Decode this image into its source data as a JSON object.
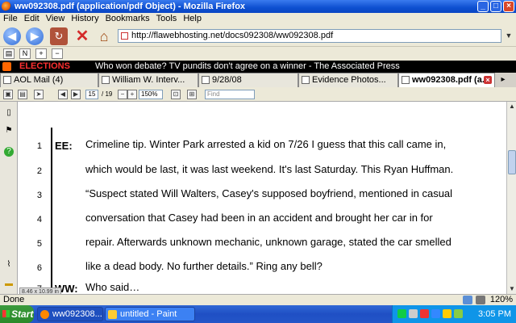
{
  "window": {
    "title": "ww092308.pdf (application/pdf Object) - Mozilla Firefox"
  },
  "menu": [
    "File",
    "Edit",
    "View",
    "History",
    "Bookmarks",
    "Tools",
    "Help"
  ],
  "nav": {
    "url": "http://flawebhosting.net/docs092308/ww092308.pdf"
  },
  "ticker": {
    "label": "ELECTIONS",
    "headline": "Who won debate? TV pundits don't agree on a winner - The Associated Press"
  },
  "tabs": [
    {
      "label": "AOL Mail (4)",
      "active": false
    },
    {
      "label": "William W. Interv...",
      "active": false
    },
    {
      "label": "9/28/08",
      "active": false
    },
    {
      "label": "Evidence Photos...",
      "active": false
    },
    {
      "label": "ww092308.pdf (a...",
      "active": true
    }
  ],
  "pdf_toolbar": {
    "page_current": "15",
    "page_total": "/ 19",
    "zoom": "150%",
    "find_placeholder": "Find"
  },
  "document": {
    "lines": [
      {
        "num": "1",
        "speaker": "EE:",
        "text": "Crimeline tip.  Winter Park arrested a kid on 7/26 I guess that this call came in,"
      },
      {
        "num": "2",
        "speaker": "",
        "text": "which would be last, it was last weekend.  It's last Saturday.  This Ryan Huffman."
      },
      {
        "num": "3",
        "speaker": "",
        "text": "“Suspect stated Will Walters, Casey's supposed boyfriend, mentioned in casual"
      },
      {
        "num": "4",
        "speaker": "",
        "text": "conversation that Casey had been in an accident and brought her car in for"
      },
      {
        "num": "5",
        "speaker": "",
        "text": "repair.  Afterwards unknown mechanic, unknown garage, stated the car smelled"
      },
      {
        "num": "6",
        "speaker": "",
        "text": "like a dead body.   No further details.”  Ring any bell?"
      },
      {
        "num": "7",
        "speaker": "WW:",
        "text": "Who said…"
      }
    ],
    "page_size": "8.46 x 10.99 in"
  },
  "status": {
    "text": "Done",
    "zoom": "120%"
  },
  "taskbar": {
    "start": "Start",
    "items": [
      {
        "label": "ww092308....",
        "active": true
      },
      {
        "label": "untitled - Paint",
        "active": false
      }
    ],
    "clock": "3:05 PM"
  },
  "colors": {
    "titlebar": "#0d4fd0",
    "ticker_label": "#ff3030",
    "taskbar": "#2456c8",
    "start": "#2a8a2a"
  }
}
